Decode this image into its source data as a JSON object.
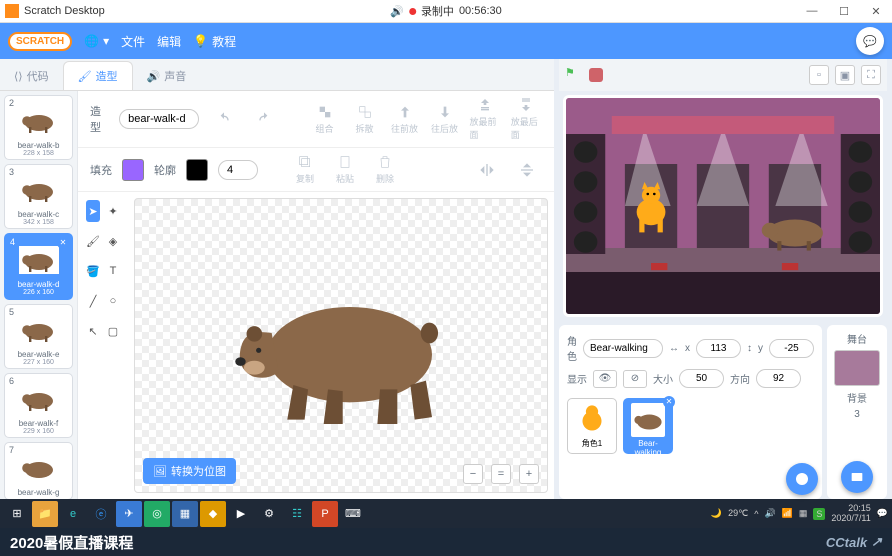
{
  "window": {
    "title": "Scratch Desktop",
    "recording_label": "录制中",
    "recording_time": "00:56:30"
  },
  "menubar": {
    "logo": "SCRATCH",
    "file": "文件",
    "edit": "编辑",
    "tutorials": "教程"
  },
  "tabs": {
    "code": "代码",
    "costumes": "造型",
    "sounds": "声音"
  },
  "costumes": [
    {
      "num": "2",
      "name": "bear-walk-b",
      "size": "228 x 158"
    },
    {
      "num": "3",
      "name": "bear-walk-c",
      "size": "342 x 158"
    },
    {
      "num": "4",
      "name": "bear-walk-d",
      "size": "226 x 160"
    },
    {
      "num": "5",
      "name": "bear-walk-e",
      "size": "227 x 160"
    },
    {
      "num": "6",
      "name": "bear-walk-f",
      "size": "229 x 160"
    },
    {
      "num": "7",
      "name": "bear-walk-g",
      "size": ""
    }
  ],
  "editor": {
    "costume_label": "造型",
    "costume_name": "bear-walk-d",
    "fill_label": "填充",
    "outline_label": "轮廓",
    "outline_width": "4",
    "fill_color": "#9966ff",
    "outline_color": "#000000",
    "ungroup": "组合",
    "group": "拆散",
    "front": "往前放",
    "back": "往后放",
    "forward": "放最前面",
    "backward": "放最后面",
    "copy": "复制",
    "paste": "粘贴",
    "delete": "删除",
    "convert": "转换为位图"
  },
  "sprite_panel": {
    "sprite_label": "角色",
    "sprite_name": "Bear-walking",
    "x_label": "x",
    "x_val": "113",
    "y_label": "y",
    "y_val": "-25",
    "show_label": "显示",
    "size_label": "大小",
    "size_val": "50",
    "direction_label": "方向",
    "direction_val": "92"
  },
  "sprites": [
    {
      "name": "角色1"
    },
    {
      "name": "Bear-walking"
    }
  ],
  "stage_panel": {
    "label": "舞台",
    "backdrops_label": "背景",
    "backdrops_count": "3"
  },
  "taskbar": {
    "temp": "29℃",
    "time": "20:15",
    "date": "2020/7/11"
  },
  "course": {
    "title": "2020暑假直播课程",
    "brand": "CCtalk"
  }
}
